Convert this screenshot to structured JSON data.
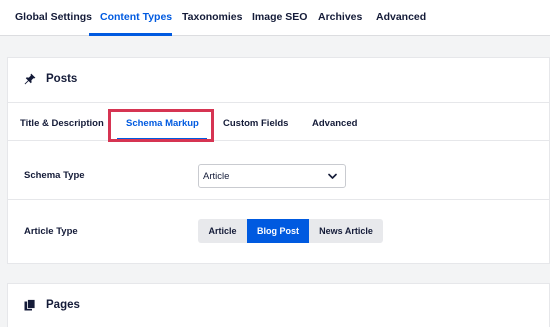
{
  "topnav": {
    "tabs": [
      {
        "label": "Global Settings",
        "active": false
      },
      {
        "label": "Content Types",
        "active": true
      },
      {
        "label": "Taxonomies",
        "active": false
      },
      {
        "label": "Image SEO",
        "active": false
      },
      {
        "label": "Archives",
        "active": false
      },
      {
        "label": "Advanced",
        "active": false
      }
    ],
    "accent_color": "#005ae0"
  },
  "posts_panel": {
    "title": "Posts",
    "icon": "pin-icon",
    "subtabs": [
      {
        "label": "Title & Description",
        "active": false
      },
      {
        "label": "Schema Markup",
        "active": true
      },
      {
        "label": "Custom Fields",
        "active": false
      },
      {
        "label": "Advanced",
        "active": false
      }
    ],
    "highlight_color": "#d63452",
    "schema_type": {
      "label": "Schema Type",
      "value": "Article"
    },
    "article_type": {
      "label": "Article Type",
      "options": [
        {
          "label": "Article",
          "selected": false
        },
        {
          "label": "Blog Post",
          "selected": true
        },
        {
          "label": "News Article",
          "selected": false
        }
      ]
    }
  },
  "pages_panel": {
    "title": "Pages",
    "icon": "pages-icon"
  }
}
